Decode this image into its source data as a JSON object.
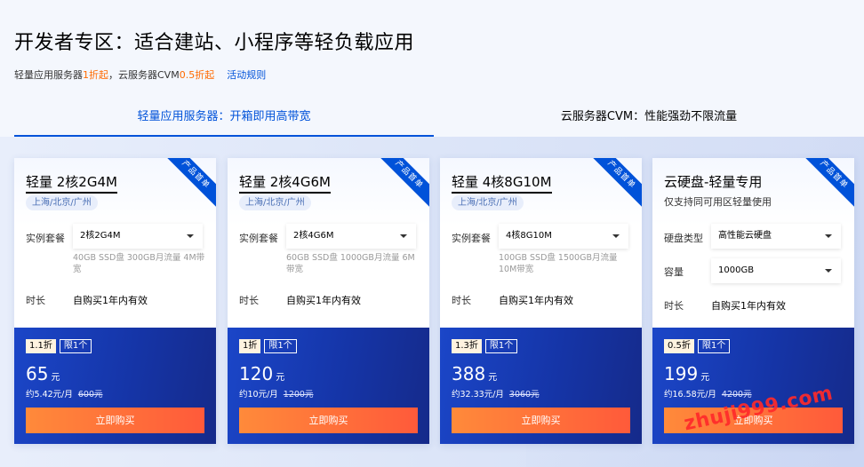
{
  "header": {
    "title": "开发者专区：适合建站、小程序等轻负载应用",
    "subtitle_part1": "轻量应用服务器",
    "subtitle_accent1": "1折起",
    "subtitle_part2": "，云服务器CVM ",
    "subtitle_accent2": "0.5折起",
    "rules_link": "活动规则"
  },
  "tabs": [
    {
      "label": "轻量应用服务器：开箱即用高带宽",
      "active": true
    },
    {
      "label": "云服务器CVM：性能强劲不限流量",
      "active": false
    }
  ],
  "ribbon_label": "产品首单",
  "cards": [
    {
      "title": "轻量 2核2G4M",
      "region": "上海/北京/广州",
      "spec_label": "实例套餐",
      "spec_value": "2核2G4M",
      "spec_note": "40GB SSD盘 300GB月流量 4M带宽",
      "duration_label": "时长",
      "duration_value": "自购买1年内有效",
      "discount": "1.1折",
      "limit": "限1个",
      "price": "65",
      "price_unit": "元",
      "monthly": "约5.42元/月",
      "original": "600元",
      "buy": "立即购买"
    },
    {
      "title": "轻量 2核4G6M",
      "region": "上海/北京/广州",
      "spec_label": "实例套餐",
      "spec_value": "2核4G6M",
      "spec_note": "60GB SSD盘 1000GB月流量 6M带宽",
      "duration_label": "时长",
      "duration_value": "自购买1年内有效",
      "discount": "1折",
      "limit": "限1个",
      "price": "120",
      "price_unit": "元",
      "monthly": "约10元/月",
      "original": "1200元",
      "buy": "立即购买"
    },
    {
      "title": "轻量 4核8G10M",
      "region": "上海/北京/广州",
      "spec_label": "实例套餐",
      "spec_value": "4核8G10M",
      "spec_note": "100GB SSD盘 1500GB月流量 10M带宽",
      "duration_label": "时长",
      "duration_value": "自购买1年内有效",
      "discount": "1.3折",
      "limit": "限1个",
      "price": "388",
      "price_unit": "元",
      "monthly": "约32.33元/月",
      "original": "3060元",
      "buy": "立即购买"
    },
    {
      "title": "云硬盘-轻量专用",
      "desc": "仅支持同可用区轻量使用",
      "disk_type_label": "硬盘类型",
      "disk_type_value": "高性能云硬盘",
      "capacity_label": "容量",
      "capacity_value": "1000GB",
      "duration_label": "时长",
      "duration_value": "自购买1年内有效",
      "discount": "0.5折",
      "limit": "限1个",
      "price": "199",
      "price_unit": "元",
      "monthly": "约16.58元/月",
      "original": "4200元",
      "buy": "立即购买"
    }
  ],
  "watermark": "zhuji999.com",
  "colors": {
    "accent": "#0052d9",
    "orange": "#ff6a00",
    "button": "#ff6a3a",
    "card_bottom": "#1b46c8"
  }
}
